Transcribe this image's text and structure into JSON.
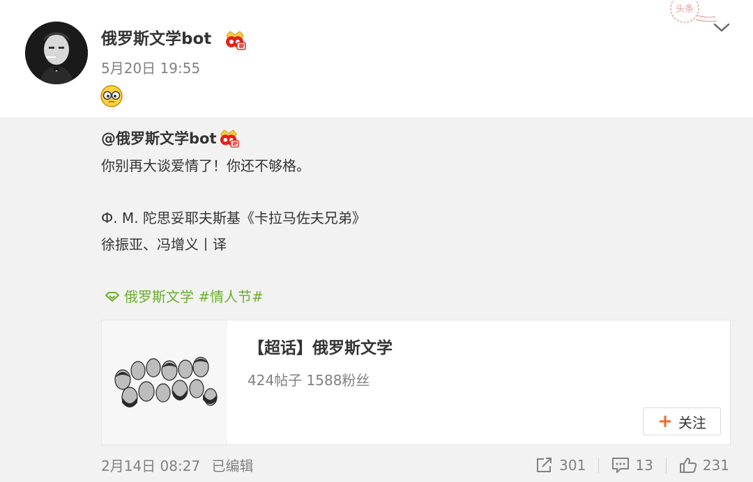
{
  "post": {
    "author": "俄罗斯文学bot",
    "time": "5月20日 19:55",
    "stamp_text": "头条"
  },
  "retweet": {
    "author": "@俄罗斯文学bot",
    "lines": [
      "你别再大谈爱情了！你还不够格。",
      "Ф. M. 陀思妥耶夫斯基《卡拉马佐夫兄弟》",
      "徐振亚、冯增义丨译"
    ],
    "topic_text": "俄罗斯文学 #情人节#",
    "card": {
      "title": "【超话】俄罗斯文学",
      "stats": "424帖子 1588粉丝",
      "follow_label": "关注"
    },
    "time": "2月14日 08:27",
    "edited": "已编辑",
    "repost_count": "301",
    "comment_count": "13",
    "like_count": "231"
  },
  "colors": {
    "topic_green": "#6bae2d",
    "follow_orange": "#f36b27",
    "badge_red": "#e2231a",
    "badge_gold": "#f7c948"
  },
  "icons": [
    "chevron-down-icon",
    "vip-badge-icon",
    "face-emoji-icon",
    "supertopic-icon",
    "repost-icon",
    "comment-icon",
    "like-icon"
  ]
}
